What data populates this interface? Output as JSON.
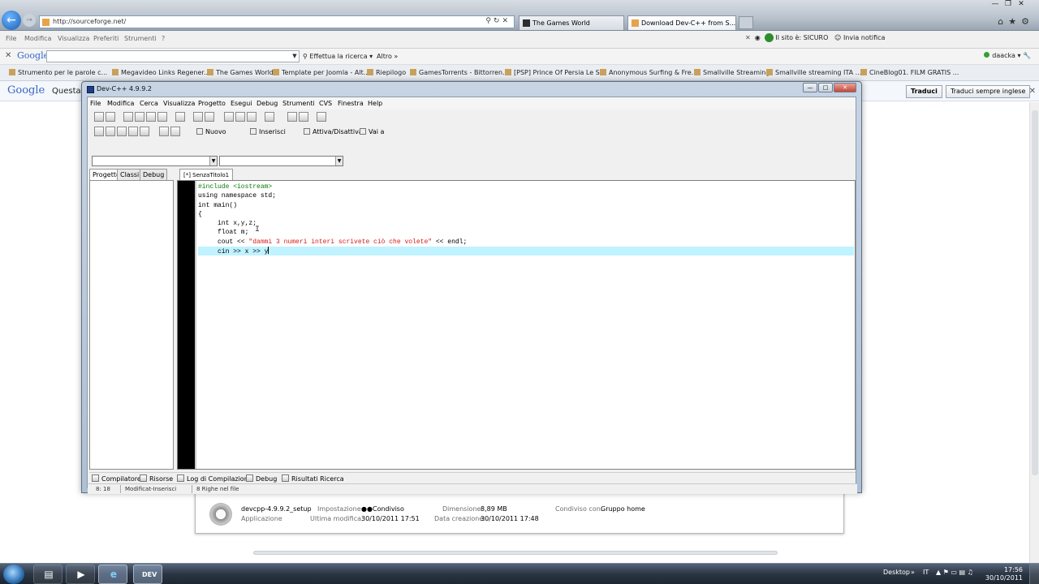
{
  "browser": {
    "address": "http://sourceforge.net/",
    "tabs": [
      {
        "label": "The Games World"
      },
      {
        "label": "Download Dev-C++ from S..."
      }
    ],
    "menu": [
      "File",
      "Modifica",
      "Visualizza",
      "Preferiti",
      "Strumenti",
      "?"
    ],
    "security_label": "Il sito è: SICURO",
    "report_label": "Invia notifica",
    "google_toolbar": {
      "logo": "Google",
      "search_value": "",
      "search_button": "Effettua la ricerca",
      "more": "Altro",
      "user": "daacka"
    },
    "favorites": [
      "Strumento per le parole c...",
      "Megavideo Links Regener...",
      "The Games World",
      "Template per Joomla - Alt...",
      "Riepilogo",
      "GamesTorrents - Bittorren...",
      "[PSP] Prince Of Persia Le S...",
      "Anonymous Surfing & Fre...",
      "Smallville Streaming",
      "Smallville streaming ITA ...",
      "CineBlog01. FILM GRATIS ..."
    ],
    "translate_bar": {
      "logo": "Google",
      "text": "Questa",
      "translate_button": "Traduci",
      "always_button": "Traduci sempre inglese"
    }
  },
  "download_panel": {
    "file_name": "devcpp-4.9.9.2_setup",
    "file_type": "Applicazione",
    "setting_label": "Impostazione:",
    "setting_value": "Condiviso",
    "modified_label": "Ultima modifica:",
    "modified_value": "30/10/2011 17:51",
    "size_label": "Dimensione:",
    "size_value": "8,89 MB",
    "created_label": "Data creazione:",
    "created_value": "30/10/2011 17:48",
    "shared_label": "Condiviso con:",
    "shared_value": "Gruppo home"
  },
  "devcpp": {
    "title": "Dev-C++ 4.9.9.2",
    "menu": [
      "File",
      "Modifica",
      "Cerca",
      "Visualizza",
      "Progetto",
      "Esegui",
      "Debug",
      "Strumenti",
      "CVS",
      "Finestra",
      "Help"
    ],
    "toolbar_labels": {
      "new": "Nuovo",
      "insert": "Inserisci",
      "toggle": "Attiva/Disattiva",
      "goto": "Vai a"
    },
    "project_tabs": [
      "Progetto",
      "Classi",
      "Debug"
    ],
    "editor_tab": "[*] SenzaTitolo1",
    "code": {
      "l1": "#include <iostream>",
      "l2": "using namespace std;",
      "l3": "int main()",
      "l4": "{",
      "l5": "     int x,y,z;",
      "l6": "     float m;",
      "l7a": "     cout << ",
      "l7b": "\"dammi 3 numeri interi scrivete ciò che volete\"",
      "l7c": " << endl;",
      "l8": "     cin >> x >> y"
    },
    "bottom_tabs": [
      "Compilatore",
      "Risorse",
      "Log di Compilazione",
      "Debug",
      "Risultati Ricerca"
    ],
    "status": {
      "position": "8: 18",
      "mode": "Modificat-Inserisci",
      "lines": "8 Righe nel file"
    }
  },
  "taskbar": {
    "desktop_label": "Desktop",
    "lang": "IT",
    "time": "17:56",
    "date": "30/10/2011",
    "dev_label": "DEV"
  },
  "colors": {
    "string": "#d61a1a",
    "preprocessor": "#0a7d0a",
    "current_line": "#c0f2ff"
  }
}
